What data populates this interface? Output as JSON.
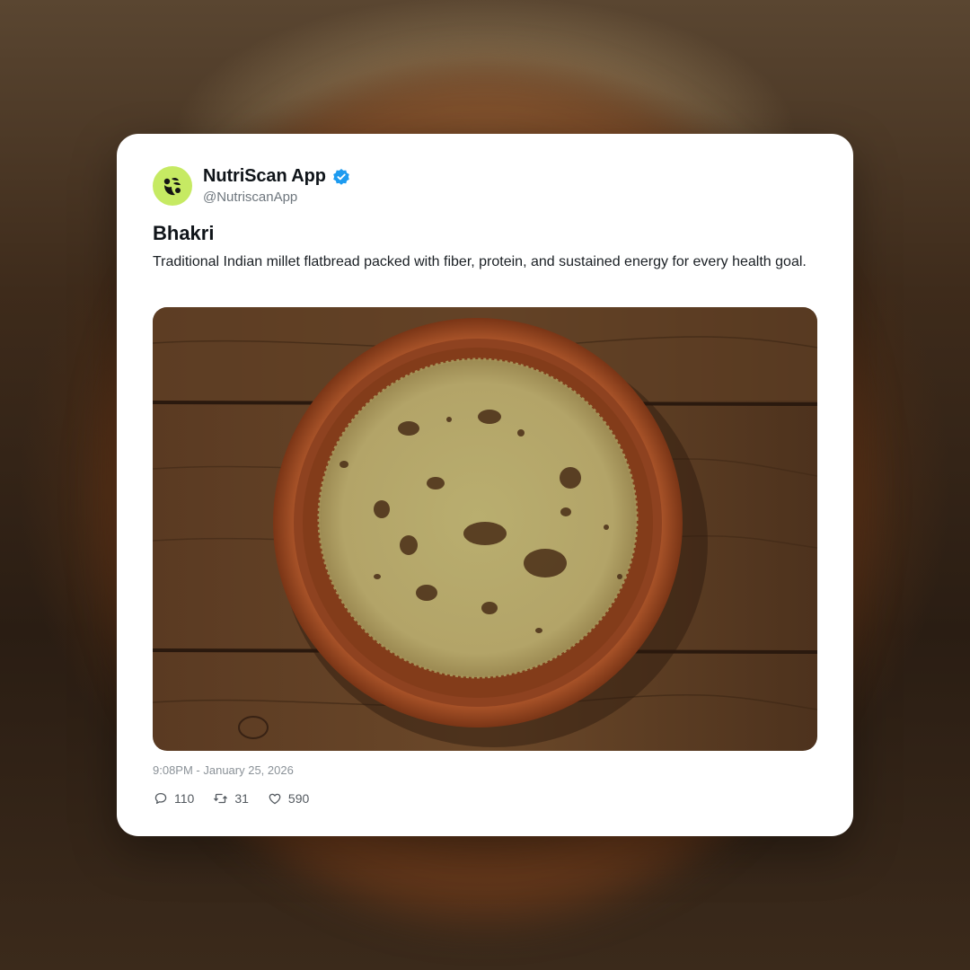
{
  "post": {
    "author": {
      "display_name": "NutriScan App",
      "handle": "@NutriscanApp",
      "verified": true,
      "avatar_icon": "nutriscan-logo-icon",
      "avatar_color": "#c6ea63"
    },
    "title": "Bhakri",
    "body": "Traditional Indian millet flatbread packed with fiber, protein, and sustained energy for every health goal.",
    "media": {
      "icon": "bhakri-flatbread-photo"
    },
    "timestamp": "9:08PM - January 25, 2026",
    "stats": {
      "replies": "110",
      "reposts": "31",
      "likes": "590"
    }
  },
  "colors": {
    "verified_badge": "#1d9bf0",
    "text_primary": "#0f1419",
    "text_secondary": "#6e767d"
  }
}
